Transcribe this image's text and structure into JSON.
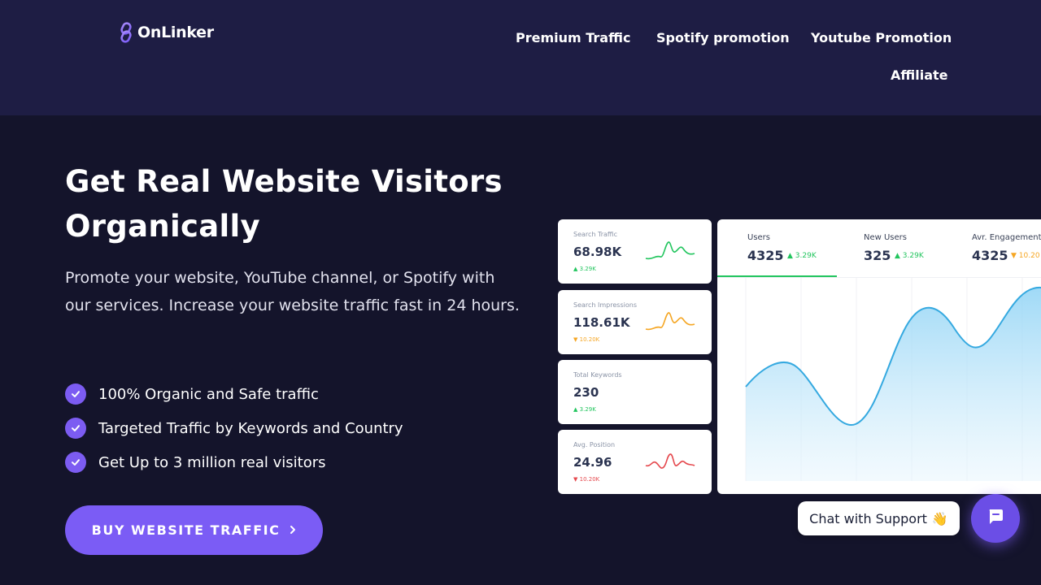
{
  "brand": {
    "name": "OnLinker",
    "accent": "#7b5cf5",
    "logo_icon": "link-icon"
  },
  "nav": {
    "items": [
      {
        "label": "Premium Traffic"
      },
      {
        "label": "Spotify promotion"
      },
      {
        "label": "Youtube Promotion"
      },
      {
        "label": "Affiliate"
      }
    ]
  },
  "hero": {
    "title": "Get Real Website Visitors Organically",
    "subtitle": "Promote your website, YouTube channel, or Spotify with our services. Increase your website traffic fast in 24 hours.",
    "features": [
      {
        "text": "100% Organic and Safe traffic",
        "icon": "check-circle-icon"
      },
      {
        "text": "Targeted Traffic by Keywords and Country",
        "icon": "check-circle-icon"
      },
      {
        "text": "Get Up to 3 million real visitors",
        "icon": "check-circle-icon"
      }
    ],
    "cta": {
      "label": "BUY WEBSITE TRAFFIC",
      "icon": "chevron-right-icon"
    }
  },
  "dashboard": {
    "cards": [
      {
        "label": "Search Traffic",
        "value": "68.98K",
        "delta": "3.29K",
        "trend": "up",
        "color": "#22c55e"
      },
      {
        "label": "Search Impressions",
        "value": "118.61K",
        "delta": "10.20K",
        "trend": "down",
        "color": "#f5a623"
      },
      {
        "label": "Total Keywords",
        "value": "230",
        "delta": "3.29K",
        "trend": "up",
        "color": "#22c55e"
      },
      {
        "label": "Avg. Position",
        "value": "24.96",
        "delta": "10.20K",
        "trend": "down",
        "color": "#e5484d"
      }
    ],
    "tabs": [
      {
        "label": "Users",
        "value": "4325",
        "delta": "3.29K",
        "trend": "up",
        "color": "#22c55e"
      },
      {
        "label": "New Users",
        "value": "325",
        "delta": "3.29K",
        "trend": "up",
        "color": "#22c55e"
      },
      {
        "label": "Avr. Engagement T",
        "value": "4325",
        "delta": "10.20",
        "trend": "down",
        "color": "#f5a623"
      }
    ],
    "chart_color": "#35a9e0"
  },
  "chat": {
    "bubble_text": "Chat with Support",
    "bubble_emoji": "👋",
    "button_icon": "chat-icon"
  }
}
